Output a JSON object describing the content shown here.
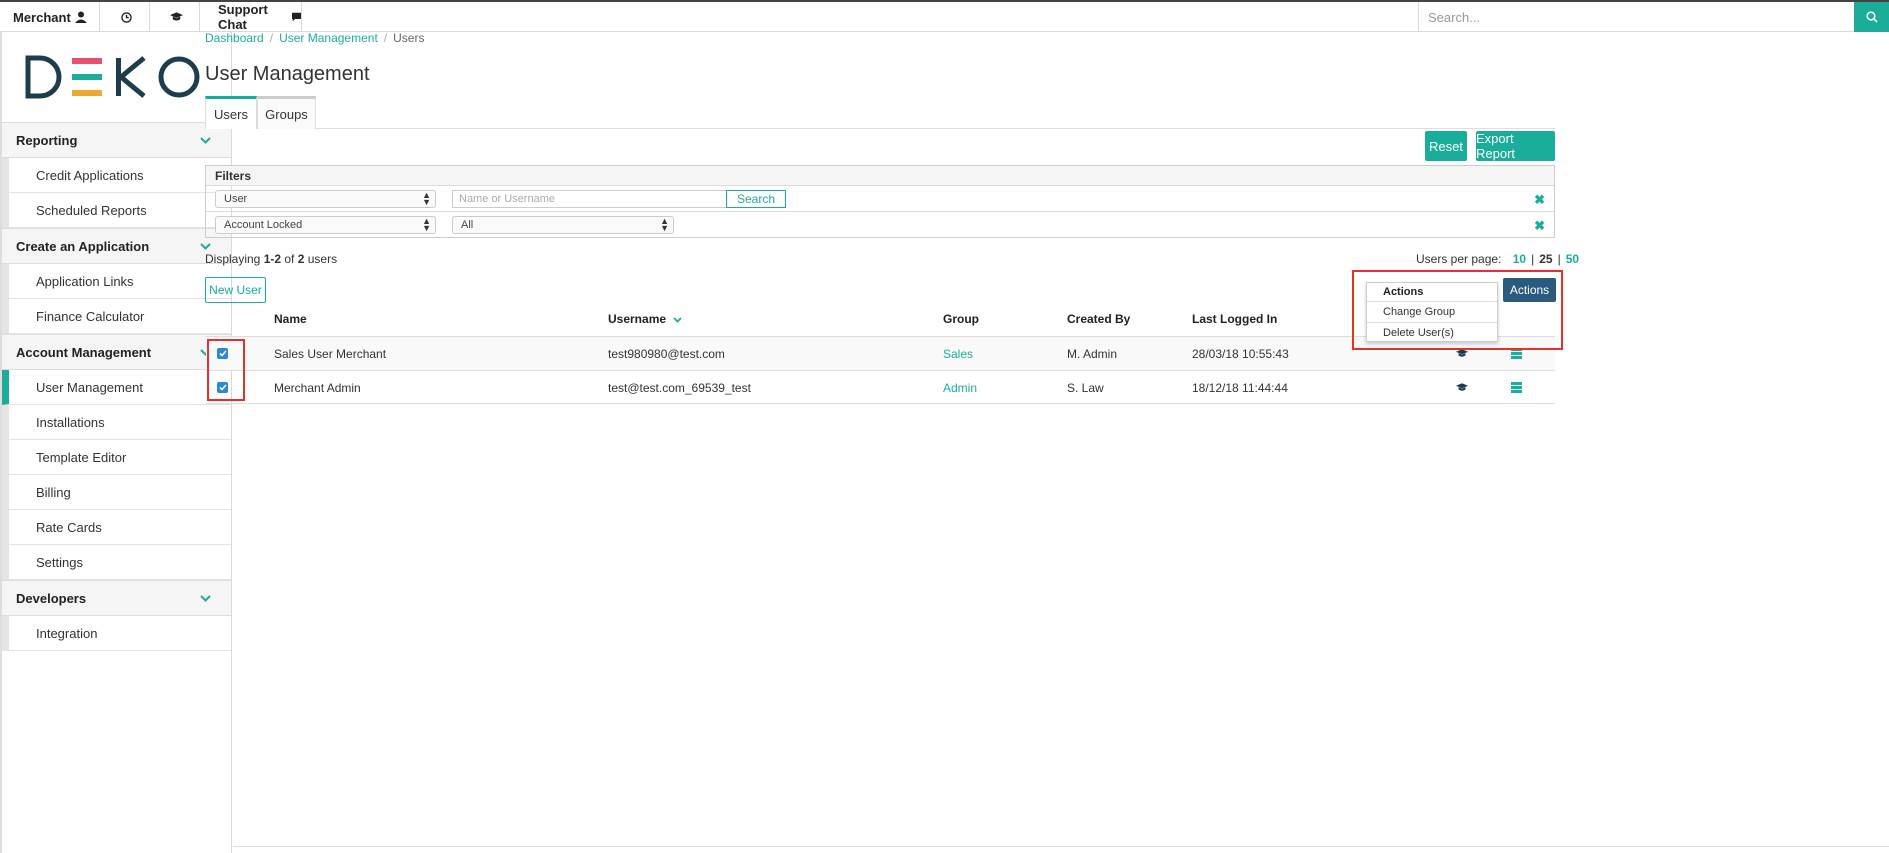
{
  "topbar": {
    "merchant": "Merchant",
    "support": "Support Chat",
    "search_placeholder": "Search..."
  },
  "logo": {
    "text": "DEKO"
  },
  "sidebar": {
    "sections": [
      {
        "label": "Reporting",
        "items": [
          "Credit Applications",
          "Scheduled Reports"
        ]
      },
      {
        "label": "Create an Application",
        "items": [
          "Application Links",
          "Finance Calculator"
        ]
      },
      {
        "label": "Account Management",
        "items": [
          "User Management",
          "Installations",
          "Template Editor",
          "Billing",
          "Rate Cards",
          "Settings"
        ]
      },
      {
        "label": "Developers",
        "items": [
          "Integration"
        ]
      }
    ]
  },
  "breadcrumb": {
    "dashboard": "Dashboard",
    "user_management": "User Management",
    "current": "Users"
  },
  "page_title": "User Management",
  "tabs": {
    "users": "Users",
    "groups": "Groups"
  },
  "buttons": {
    "reset": "Reset",
    "export": "Export Report",
    "new_user": "New User",
    "actions": "Actions",
    "search": "Search"
  },
  "filters": {
    "heading": "Filters",
    "row1": {
      "field": "User",
      "placeholder": "Name or Username"
    },
    "row2": {
      "field": "Account Locked",
      "value": "All"
    }
  },
  "displaying": {
    "prefix": "Displaying ",
    "range": "1-2",
    "of": " of ",
    "total": "2",
    "suffix": " users"
  },
  "per_page": {
    "label": "Users per page:",
    "opt1": "10",
    "opt2": "25",
    "opt3": "50"
  },
  "table": {
    "headers": {
      "name": "Name",
      "username": "Username",
      "group": "Group",
      "created_by": "Created By",
      "last_logged_in": "Last Logged In"
    },
    "rows": [
      {
        "name": "Sales User Merchant",
        "username": "test980980@test.com",
        "group": "Sales",
        "created_by": "M. Admin",
        "last_logged_in": "28/03/18 10:55:43",
        "checked": true
      },
      {
        "name": "Merchant Admin",
        "username": "test@test.com_69539_test",
        "group": "Admin",
        "created_by": "S. Law",
        "last_logged_in": "18/12/18 11:44:44",
        "checked": true
      }
    ]
  },
  "actions_menu": {
    "heading": "Actions",
    "change_group": "Change Group",
    "delete_users": "Delete User(s)"
  },
  "colors": {
    "accent": "#1aae9a",
    "actions_button": "#2a5a7e",
    "highlight": "#e5312a",
    "checkbox": "#2b87d8"
  }
}
